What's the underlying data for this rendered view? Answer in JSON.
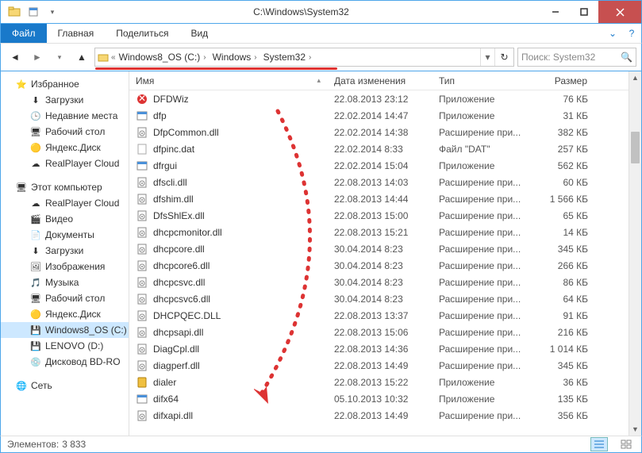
{
  "window": {
    "title": "C:\\Windows\\System32"
  },
  "ribbon": {
    "file": "Файл",
    "home": "Главная",
    "share": "Поделиться",
    "view": "Вид"
  },
  "breadcrumb": [
    "Windows8_OS (C:)",
    "Windows",
    "System32"
  ],
  "search": {
    "placeholder": "Поиск: System32"
  },
  "nav": {
    "favorites": {
      "label": "Избранное",
      "items": [
        "Загрузки",
        "Недавние места",
        "Рабочий стол",
        "Яндекс.Диск",
        "RealPlayer Cloud"
      ]
    },
    "computer": {
      "label": "Этот компьютер",
      "items": [
        "RealPlayer Cloud",
        "Видео",
        "Документы",
        "Загрузки",
        "Изображения",
        "Музыка",
        "Рабочий стол",
        "Яндекс.Диск",
        "Windows8_OS (C:)",
        "LENOVO (D:)",
        "Дисковод BD-RO"
      ]
    },
    "network": {
      "label": "Сеть"
    }
  },
  "columns": {
    "name": "Имя",
    "date": "Дата изменения",
    "type": "Тип",
    "size": "Размер"
  },
  "files": [
    {
      "icon": "app-red",
      "name": "DFDWiz",
      "date": "22.08.2013 23:12",
      "type": "Приложение",
      "size": "76 КБ"
    },
    {
      "icon": "app",
      "name": "dfp",
      "date": "22.02.2014 14:47",
      "type": "Приложение",
      "size": "31 КБ"
    },
    {
      "icon": "dll",
      "name": "DfpCommon.dll",
      "date": "22.02.2014 14:38",
      "type": "Расширение при...",
      "size": "382 КБ"
    },
    {
      "icon": "dat",
      "name": "dfpinc.dat",
      "date": "22.02.2014 8:33",
      "type": "Файл \"DAT\"",
      "size": "257 КБ"
    },
    {
      "icon": "app",
      "name": "dfrgui",
      "date": "22.02.2014 15:04",
      "type": "Приложение",
      "size": "562 КБ"
    },
    {
      "icon": "dll",
      "name": "dfscli.dll",
      "date": "22.08.2013 14:03",
      "type": "Расширение при...",
      "size": "60 КБ"
    },
    {
      "icon": "dll",
      "name": "dfshim.dll",
      "date": "22.08.2013 14:44",
      "type": "Расширение при...",
      "size": "1 566 КБ"
    },
    {
      "icon": "dll",
      "name": "DfsShlEx.dll",
      "date": "22.08.2013 15:00",
      "type": "Расширение при...",
      "size": "65 КБ"
    },
    {
      "icon": "dll",
      "name": "dhcpcmonitor.dll",
      "date": "22.08.2013 15:21",
      "type": "Расширение при...",
      "size": "14 КБ"
    },
    {
      "icon": "dll",
      "name": "dhcpcore.dll",
      "date": "30.04.2014 8:23",
      "type": "Расширение при...",
      "size": "345 КБ"
    },
    {
      "icon": "dll",
      "name": "dhcpcore6.dll",
      "date": "30.04.2014 8:23",
      "type": "Расширение при...",
      "size": "266 КБ"
    },
    {
      "icon": "dll",
      "name": "dhcpcsvc.dll",
      "date": "30.04.2014 8:23",
      "type": "Расширение при...",
      "size": "86 КБ"
    },
    {
      "icon": "dll",
      "name": "dhcpcsvc6.dll",
      "date": "30.04.2014 8:23",
      "type": "Расширение при...",
      "size": "64 КБ"
    },
    {
      "icon": "dll",
      "name": "DHCPQEC.DLL",
      "date": "22.08.2013 13:37",
      "type": "Расширение при...",
      "size": "91 КБ"
    },
    {
      "icon": "dll",
      "name": "dhcpsapi.dll",
      "date": "22.08.2013 15:06",
      "type": "Расширение при...",
      "size": "216 КБ"
    },
    {
      "icon": "dll",
      "name": "DiagCpl.dll",
      "date": "22.08.2013 14:36",
      "type": "Расширение при...",
      "size": "1 014 КБ"
    },
    {
      "icon": "dll",
      "name": "diagperf.dll",
      "date": "22.08.2013 14:49",
      "type": "Расширение при...",
      "size": "345 КБ"
    },
    {
      "icon": "app-phone",
      "name": "dialer",
      "date": "22.08.2013 15:22",
      "type": "Приложение",
      "size": "36 КБ"
    },
    {
      "icon": "app",
      "name": "difx64",
      "date": "05.10.2013 10:32",
      "type": "Приложение",
      "size": "135 КБ"
    },
    {
      "icon": "dll",
      "name": "difxapi.dll",
      "date": "22.08.2013 14:49",
      "type": "Расширение при...",
      "size": "356 КБ"
    }
  ],
  "status": {
    "count_label": "Элементов:",
    "count": "3 833"
  },
  "icons_alt": {
    "folder": "📁",
    "star": "⭐",
    "computer": "🖥",
    "network": "🌐",
    "disk": "💾",
    "search": "🔍"
  }
}
